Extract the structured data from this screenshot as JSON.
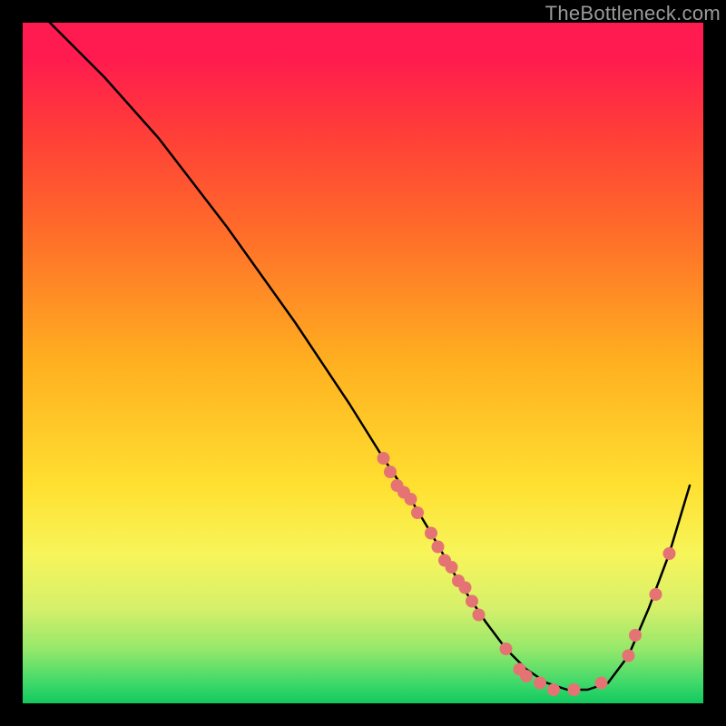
{
  "watermark": "TheBottleneck.com",
  "chart_data": {
    "type": "line",
    "title": "",
    "xlabel": "",
    "ylabel": "",
    "xlim": [
      0,
      100
    ],
    "ylim": [
      0,
      100
    ],
    "grid": false,
    "series": [
      {
        "name": "curve",
        "color": "#000000",
        "x": [
          4,
          8,
          12,
          20,
          30,
          40,
          48,
          53,
          57,
          60,
          64,
          68,
          71,
          74,
          77,
          80,
          83,
          86,
          89,
          92,
          95,
          98
        ],
        "y": [
          100,
          96,
          92,
          83,
          70,
          56,
          44,
          36,
          30,
          25,
          18,
          12,
          8,
          5,
          3,
          2,
          2,
          3,
          7,
          14,
          22,
          32
        ]
      }
    ],
    "markers": {
      "style": "circle",
      "color": "#e57373",
      "radius": 7,
      "points": [
        {
          "x": 53,
          "y": 36
        },
        {
          "x": 54,
          "y": 34
        },
        {
          "x": 55,
          "y": 32
        },
        {
          "x": 56,
          "y": 31
        },
        {
          "x": 57,
          "y": 30
        },
        {
          "x": 58,
          "y": 28
        },
        {
          "x": 60,
          "y": 25
        },
        {
          "x": 61,
          "y": 23
        },
        {
          "x": 62,
          "y": 21
        },
        {
          "x": 63,
          "y": 20
        },
        {
          "x": 64,
          "y": 18
        },
        {
          "x": 65,
          "y": 17
        },
        {
          "x": 66,
          "y": 15
        },
        {
          "x": 67,
          "y": 13
        },
        {
          "x": 71,
          "y": 8
        },
        {
          "x": 73,
          "y": 5
        },
        {
          "x": 74,
          "y": 4
        },
        {
          "x": 76,
          "y": 3
        },
        {
          "x": 78,
          "y": 2
        },
        {
          "x": 81,
          "y": 2
        },
        {
          "x": 85,
          "y": 3
        },
        {
          "x": 89,
          "y": 7
        },
        {
          "x": 90,
          "y": 10
        },
        {
          "x": 93,
          "y": 16
        },
        {
          "x": 95,
          "y": 22
        }
      ]
    }
  }
}
